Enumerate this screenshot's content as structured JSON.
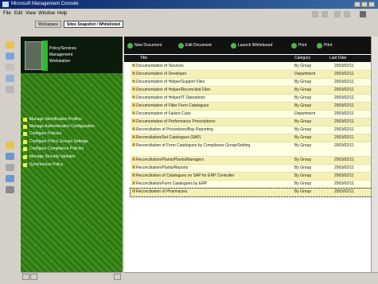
{
  "window": {
    "title": "Microsoft Management Console"
  },
  "menu": {
    "items": [
      "File",
      "Edit",
      "View",
      "Window",
      "Help"
    ]
  },
  "tabs": [
    {
      "label": "Workspace"
    },
    {
      "label": "Sites Snapshot / Whitelisted"
    }
  ],
  "logo": {
    "lines": [
      "Policy/Services",
      "Management",
      "Workstation"
    ]
  },
  "nav": {
    "items": [
      "Manage Identification Profiles",
      "Manage Authentication Configuration",
      "Configure Policies",
      "Configure Policy Groups Settings",
      "Configure Compliance Policies",
      "Manage Security Updates",
      "Synchronize Policy"
    ]
  },
  "toolbar": {
    "buttons": [
      "New Document",
      "Edit Document",
      "Launch Whiteboard",
      "Print",
      "Print"
    ]
  },
  "table": {
    "headers": [
      "Title",
      "Category",
      "Last Date"
    ],
    "rows": [
      {
        "title": "Documentation of Services",
        "category": "By Group",
        "date": "2003/02/11",
        "tall": false
      },
      {
        "title": "Documentation of Developer",
        "category": "Department",
        "date": "2003/02/11",
        "tall": false
      },
      {
        "title": "Documentation of Helper/Support Files",
        "category": "By Group",
        "date": "2003/02/11",
        "tall": false
      },
      {
        "title": "Documentation of Helper/Reconciled Files",
        "category": "By Group",
        "date": "2003/02/11",
        "tall": false
      },
      {
        "title": "Documentation of Helper/IT Operations",
        "category": "By Group",
        "date": "2003/02/11",
        "tall": false
      },
      {
        "title": "Documentation of Filter Form Catalogues",
        "category": "By Group",
        "date": "2003/02/11",
        "tall": false
      },
      {
        "title": "Documentation of Failure Case",
        "category": "Department",
        "date": "2003/02/11",
        "tall": false
      },
      {
        "title": "Documentation of Performance Prescriptions",
        "category": "By Group",
        "date": "2003/02/11",
        "tall": false
      },
      {
        "title": "Reconciliation of Procedures/Bay Reporting",
        "category": "By Group",
        "date": "2003/02/11",
        "tall": false
      },
      {
        "title": "Reconciliation/Set Catalogues (SAP)",
        "category": "By Group",
        "date": "2003/02/11",
        "tall": false
      },
      {
        "title": "Reconciliation of Form Catalogues by Compliance Group/Setting",
        "category": "By Group",
        "date": "2003/02/11",
        "tall": true
      },
      {
        "title": "Reconciliation/Plants/Plants/Managers",
        "category": "By Group",
        "date": "2003/02/11",
        "tall": false
      },
      {
        "title": "Reconciliation/Plants/Reports",
        "category": "By Group",
        "date": "2003/02/11",
        "tall": false
      },
      {
        "title": "Reconciliation of Catalogues on SAP for ERP Controller",
        "category": "By Group",
        "date": "2003/02/11",
        "tall": false
      },
      {
        "title": "Reconciliation/Form Catalogues by ERP",
        "category": "By Group",
        "date": "2003/02/11",
        "tall": false
      },
      {
        "title": "Reconciliation of Pharmacies",
        "category": "By Group",
        "date": "2003/02/11",
        "tall": false
      }
    ]
  },
  "colors": {
    "accent": "#3f8d1e",
    "row_odd": "#ffffe2",
    "row_even": "#f4f0b8",
    "toolbar": "#111111"
  }
}
